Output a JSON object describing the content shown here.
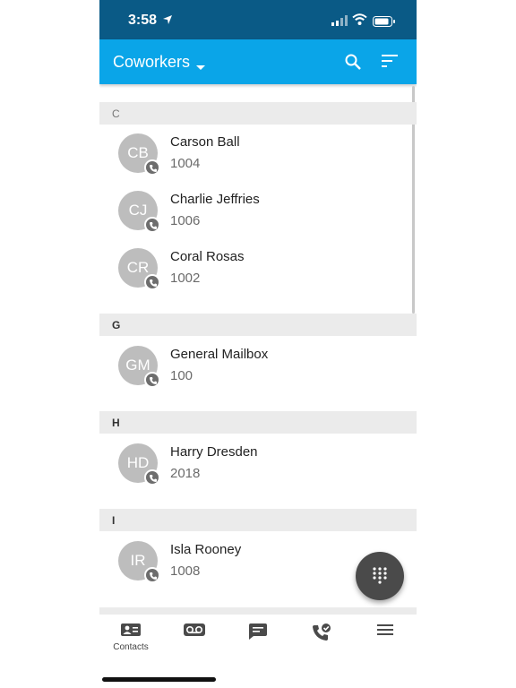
{
  "status_bar": {
    "time": "3:58"
  },
  "app_bar": {
    "title": "Coworkers"
  },
  "sections": [
    {
      "letter": "C",
      "contacts": [
        {
          "initials": "CB",
          "name": "Carson Ball",
          "extension": "1004"
        },
        {
          "initials": "CJ",
          "name": "Charlie Jeffries",
          "extension": "1006"
        },
        {
          "initials": "CR",
          "name": "Coral Rosas",
          "extension": "1002"
        }
      ]
    },
    {
      "letter": "G",
      "contacts": [
        {
          "initials": "GM",
          "name": "General Mailbox",
          "extension": "100"
        }
      ]
    },
    {
      "letter": "H",
      "contacts": [
        {
          "initials": "HD",
          "name": "Harry Dresden",
          "extension": "2018"
        }
      ]
    },
    {
      "letter": "I",
      "contacts": [
        {
          "initials": "IR",
          "name": "Isla Rooney",
          "extension": "1008"
        }
      ]
    }
  ],
  "tab_bar": {
    "contacts_label": "Contacts",
    "icons": [
      "contacts-icon",
      "voicemail-icon",
      "message-icon",
      "call-history-icon",
      "menu-icon"
    ]
  },
  "colors": {
    "status_bar": "#0a5a86",
    "app_bar": "#0aa5e8",
    "avatar": "#bdbdbd",
    "fab": "#4a4a4a",
    "section_header": "#ebebeb"
  }
}
